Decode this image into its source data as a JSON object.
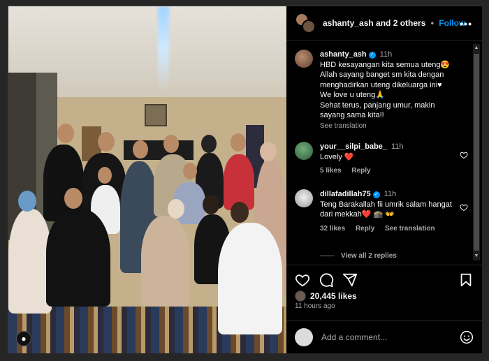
{
  "header": {
    "username": "ashanty_ash",
    "others_text": "and 2 others",
    "separator": "•",
    "follow_label": "Follow",
    "more_label": "•••"
  },
  "caption": {
    "username": "ashanty_ash",
    "time": "11h",
    "lines": [
      "HBD kesayangan kita semua uteng😍",
      "Allah sayang banget sm kita dengan menghadirkan uteng dikeluarga ini♥",
      "We love u uteng🙏",
      "Sehat terus, panjang umur, makin sayang sama kita!!"
    ],
    "see_translation": "See translation"
  },
  "comments": [
    {
      "username": "your__silpi_babe_",
      "time": "11h",
      "text": "Lovely ❤️",
      "likes": "5 likes",
      "reply_label": "Reply"
    },
    {
      "username": "dillafadillah75",
      "time": "11h",
      "text": "Teng Barakallah fii umrik salam hangat dari mekkah❤️ 🕋 👐",
      "likes": "32 likes",
      "reply_label": "Reply",
      "see_translation": "See translation"
    }
  ],
  "view_replies": "View all 2 replies",
  "likes_count": "20,445 likes",
  "time_ago": "11 hours ago",
  "add_comment_placeholder": "Add a comment...",
  "icons": {
    "like": "heart-icon",
    "comment": "comment-icon",
    "share": "send-icon",
    "save": "bookmark-icon",
    "emoji": "smiley-icon",
    "verified": "verified-badge-icon",
    "tagged_user": "person-icon"
  },
  "colors": {
    "accent": "#0095f6",
    "background": "#000000",
    "muted_text": "#a8a8a8"
  }
}
